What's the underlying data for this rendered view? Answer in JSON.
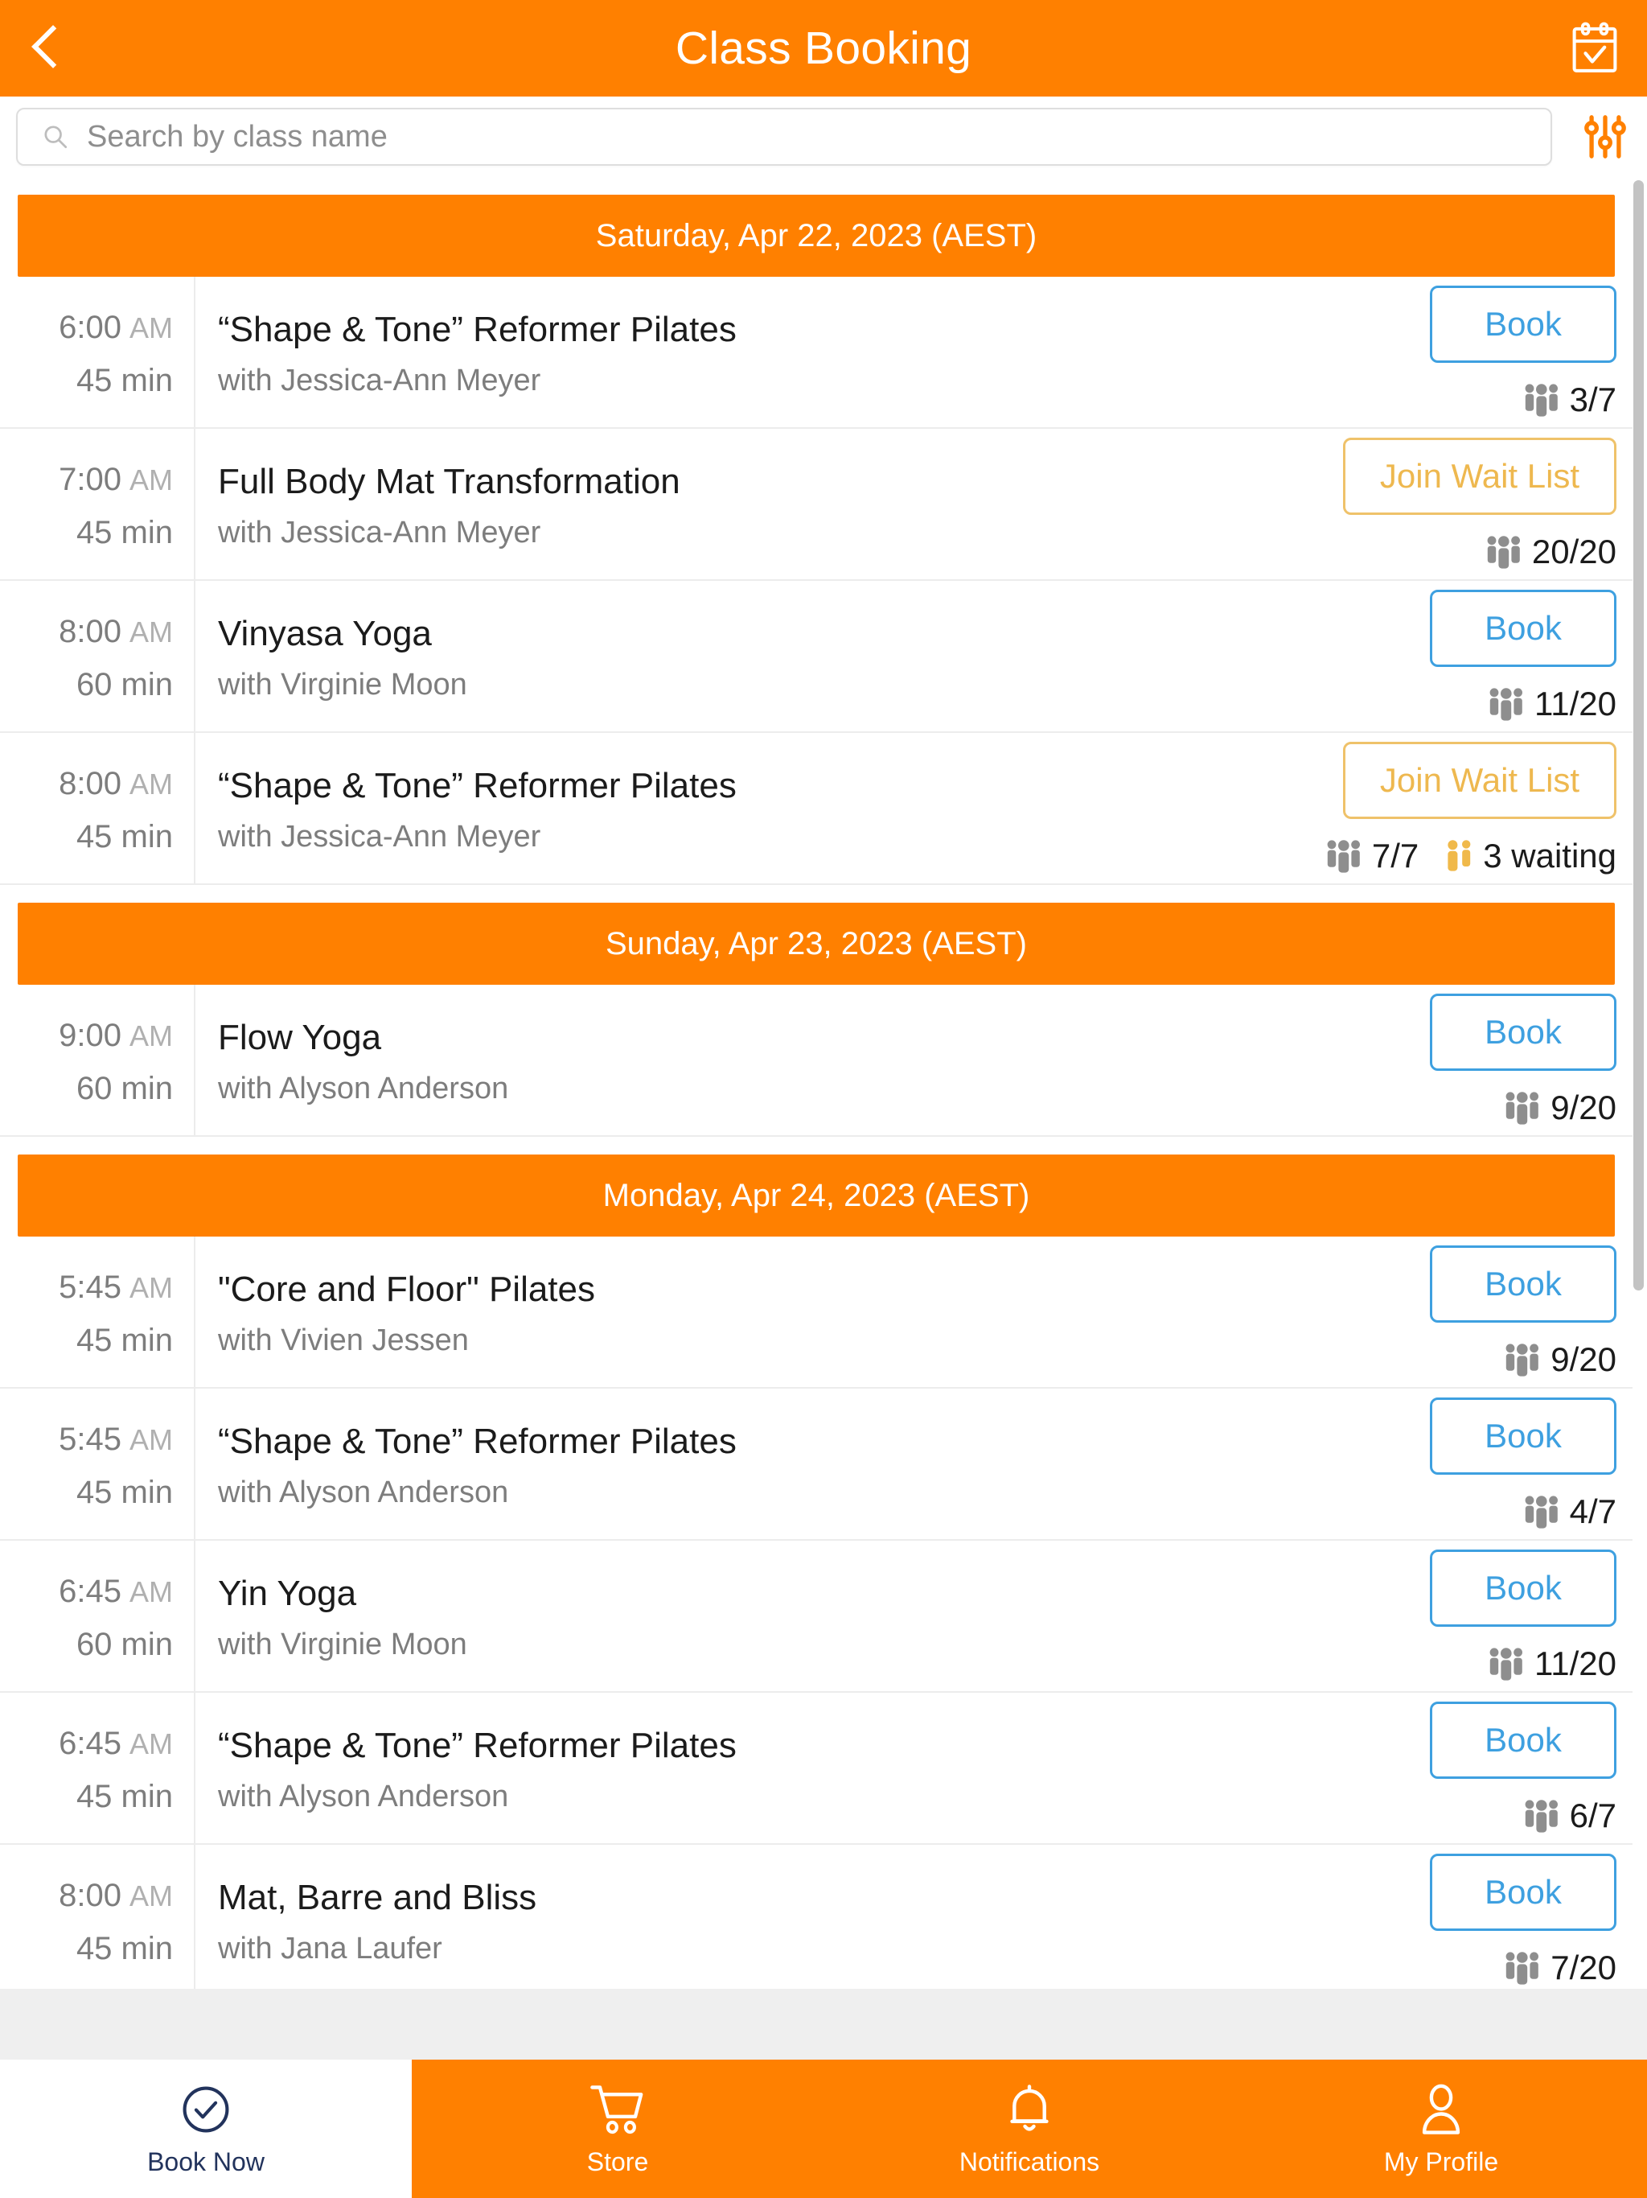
{
  "header": {
    "title": "Class Booking",
    "back_icon": "chevron-left-icon",
    "calendar_icon": "calendar-check-icon",
    "bg_color": "#FF8000"
  },
  "search": {
    "placeholder": "Search by class name",
    "value": "",
    "search_icon": "search-icon",
    "filter_icon": "sliders-filter-icon",
    "filter_color": "#FF8000"
  },
  "colors": {
    "brand_orange": "#FF8000",
    "book_blue": "#3EA0E0",
    "wait_amber": "#EEB84F",
    "active_tab_navy": "#22335C",
    "divider": "#ECECEC"
  },
  "days": [
    {
      "label": "Saturday, Apr 22, 2023 (AEST)",
      "classes": [
        {
          "time": "6:00",
          "ampm": "AM",
          "duration": "45 min",
          "name": "“Shape & Tone” Reformer Pilates",
          "instructor": "with Jessica-Ann Meyer",
          "action_label": "Book",
          "action_type": "book",
          "capacity": "3/7",
          "capacity_icon": "people-group-icon",
          "waiting": null
        },
        {
          "time": "7:00",
          "ampm": "AM",
          "duration": "45 min",
          "name": "Full Body Mat Transformation",
          "instructor": "with Jessica-Ann Meyer",
          "action_label": "Join Wait List",
          "action_type": "waitlist",
          "capacity": "20/20",
          "capacity_icon": "people-group-icon",
          "waiting": null
        },
        {
          "time": "8:00",
          "ampm": "AM",
          "duration": "60 min",
          "name": "Vinyasa Yoga",
          "instructor": "with Virginie Moon",
          "action_label": "Book",
          "action_type": "book",
          "capacity": "11/20",
          "capacity_icon": "people-group-icon",
          "waiting": null
        },
        {
          "time": "8:00",
          "ampm": "AM",
          "duration": "45 min",
          "name": "“Shape & Tone” Reformer Pilates",
          "instructor": "with Jessica-Ann Meyer",
          "action_label": "Join Wait List",
          "action_type": "waitlist",
          "capacity": "7/7",
          "capacity_icon": "people-group-icon",
          "waiting": "3 waiting",
          "waiting_icon": "people-waiting-icon"
        }
      ]
    },
    {
      "label": "Sunday, Apr 23, 2023 (AEST)",
      "classes": [
        {
          "time": "9:00",
          "ampm": "AM",
          "duration": "60 min",
          "name": "Flow Yoga",
          "instructor": "with Alyson Anderson",
          "action_label": "Book",
          "action_type": "book",
          "capacity": "9/20",
          "capacity_icon": "people-group-icon",
          "waiting": null
        }
      ]
    },
    {
      "label": "Monday, Apr 24, 2023 (AEST)",
      "classes": [
        {
          "time": "5:45",
          "ampm": "AM",
          "duration": "45 min",
          "name": "\"Core and Floor\" Pilates",
          "instructor": "with Vivien Jessen",
          "action_label": "Book",
          "action_type": "book",
          "capacity": "9/20",
          "capacity_icon": "people-group-icon",
          "waiting": null
        },
        {
          "time": "5:45",
          "ampm": "AM",
          "duration": "45 min",
          "name": "“Shape & Tone” Reformer Pilates",
          "instructor": "with Alyson Anderson",
          "action_label": "Book",
          "action_type": "book",
          "capacity": "4/7",
          "capacity_icon": "people-group-icon",
          "waiting": null
        },
        {
          "time": "6:45",
          "ampm": "AM",
          "duration": "60 min",
          "name": "Yin Yoga",
          "instructor": "with Virginie Moon",
          "action_label": "Book",
          "action_type": "book",
          "capacity": "11/20",
          "capacity_icon": "people-group-icon",
          "waiting": null
        },
        {
          "time": "6:45",
          "ampm": "AM",
          "duration": "45 min",
          "name": "“Shape & Tone” Reformer Pilates",
          "instructor": "with Alyson Anderson",
          "action_label": "Book",
          "action_type": "book",
          "capacity": "6/7",
          "capacity_icon": "people-group-icon",
          "waiting": null
        },
        {
          "time": "8:00",
          "ampm": "AM",
          "duration": "45 min",
          "name": "Mat, Barre and Bliss",
          "instructor": "with Jana Laufer",
          "action_label": "Book",
          "action_type": "book",
          "capacity": "7/20",
          "capacity_icon": "people-group-icon",
          "waiting": null
        }
      ]
    }
  ],
  "tabbar": {
    "items": [
      {
        "label": "Book Now",
        "icon": "check-circle-icon",
        "active": true
      },
      {
        "label": "Store",
        "icon": "shopping-cart-icon",
        "active": false
      },
      {
        "label": "Notifications",
        "icon": "bell-icon",
        "active": false
      },
      {
        "label": "My Profile",
        "icon": "user-icon",
        "active": false
      }
    ]
  }
}
